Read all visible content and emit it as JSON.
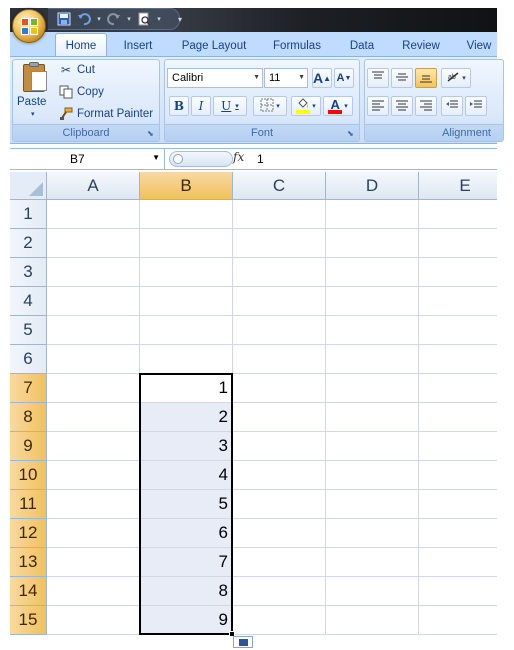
{
  "quick_access": {
    "icons": [
      "save-icon",
      "undo-icon",
      "redo-icon",
      "print-preview-icon",
      "customize-icon"
    ]
  },
  "ribbon": {
    "tabs": [
      {
        "label": "Home",
        "active": true
      },
      {
        "label": "Insert",
        "active": false
      },
      {
        "label": "Page Layout",
        "active": false
      },
      {
        "label": "Formulas",
        "active": false
      },
      {
        "label": "Data",
        "active": false
      },
      {
        "label": "Review",
        "active": false
      },
      {
        "label": "View",
        "active": false
      }
    ],
    "clipboard": {
      "paste_label": "Paste",
      "cut_label": "Cut",
      "copy_label": "Copy",
      "format_painter_label": "Format Painter",
      "group_label": "Clipboard"
    },
    "font": {
      "font_name": "Calibri",
      "font_size": "11",
      "bold": "B",
      "italic": "I",
      "underline": "U",
      "grow": "A",
      "shrink": "A",
      "font_color_label": "A",
      "group_label": "Font",
      "highlight_color": "#ffff00",
      "font_color": "#ff0000"
    },
    "alignment": {
      "group_label": "Alignment"
    }
  },
  "formula_bar": {
    "name_box": "B7",
    "fx": "fx",
    "value": "1"
  },
  "sheet": {
    "columns": [
      "A",
      "B",
      "C",
      "D",
      "E"
    ],
    "selected_column": "B",
    "rows": [
      "1",
      "2",
      "3",
      "4",
      "5",
      "6",
      "7",
      "8",
      "9",
      "10",
      "11",
      "12",
      "13",
      "14",
      "15"
    ],
    "selected_rows": [
      "7",
      "8",
      "9",
      "10",
      "11",
      "12",
      "13",
      "14",
      "15"
    ],
    "b_values": {
      "7": "1",
      "8": "2",
      "9": "3",
      "10": "4",
      "11": "5",
      "12": "6",
      "13": "7",
      "14": "8",
      "15": "9"
    },
    "active_cell": "B7",
    "selection": "B7:B15"
  },
  "colors": {
    "selected_header": "#f1c15f",
    "ribbon_bg": "#d6e6fa",
    "selection_fill": "#e8ecf7"
  }
}
